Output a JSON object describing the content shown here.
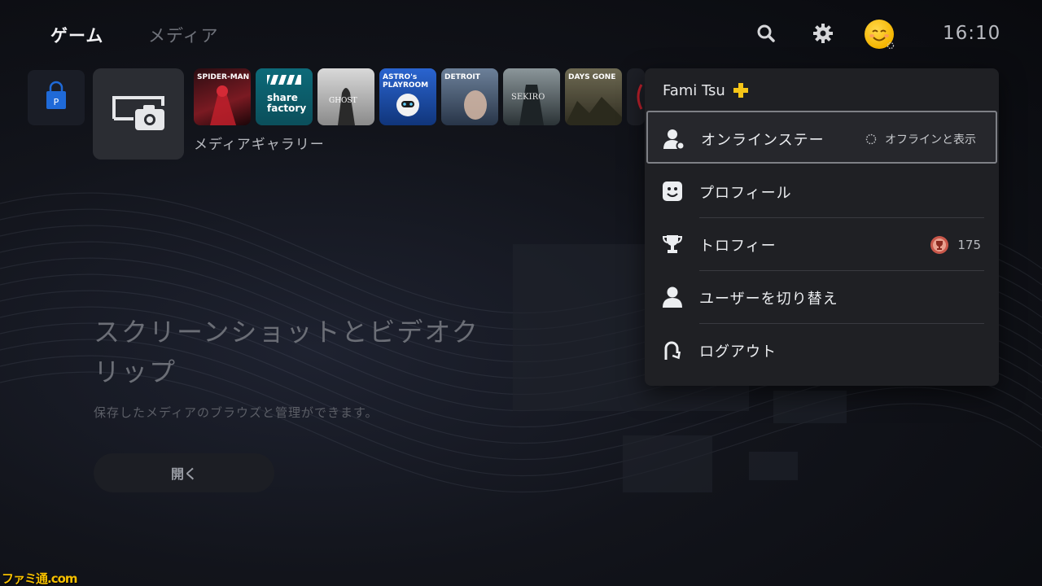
{
  "nav": {
    "tab_games": "ゲーム",
    "tab_media": "メディア",
    "clock": "16:10"
  },
  "tiles": [
    {
      "id": "spiderman",
      "label": "SPIDER-MAN",
      "color": "#3a1216"
    },
    {
      "id": "sharefactory",
      "label": "share factory",
      "color": "#0f5d6b"
    },
    {
      "id": "ghost",
      "label": "GHOST",
      "color": "#b9b9b9"
    },
    {
      "id": "astro",
      "label": "ASTRO's PLAYROOM",
      "color": "#1b4aa5"
    },
    {
      "id": "detroit",
      "label": "DETROIT",
      "color": "#3b4d66"
    },
    {
      "id": "sekiro",
      "label": "SEKIRO",
      "color": "#4d5a5f"
    },
    {
      "id": "daysgone",
      "label": "DAYS GONE",
      "color": "#4b4734"
    }
  ],
  "media_tile": {
    "caption": "メディアギャラリー"
  },
  "hero": {
    "title": "スクリーンショットとビデオクリップ",
    "description": "保存したメディアのブラウズと管理ができます。",
    "open_button": "開く"
  },
  "profile_menu": {
    "username": "Fami Tsu",
    "items": [
      {
        "label": "オンラインステー",
        "value": "オフラインと表示",
        "icon": "online-status-icon"
      },
      {
        "label": "プロフィール",
        "icon": "profile-face-icon"
      },
      {
        "label": "トロフィー",
        "value": "175",
        "icon": "trophy-icon"
      },
      {
        "label": "ユーザーを切り替え",
        "icon": "switch-user-icon"
      },
      {
        "label": "ログアウト",
        "icon": "logout-icon"
      }
    ]
  },
  "watermark": "ファミ通.com",
  "colors": {
    "accent": "#f4b400",
    "plus": "#f5c518",
    "menu_bg": "#1f2024"
  }
}
